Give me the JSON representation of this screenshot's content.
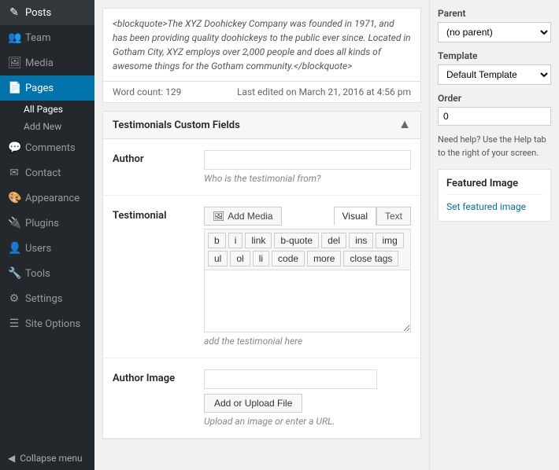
{
  "sidebar": {
    "items": [
      {
        "id": "posts",
        "label": "Posts",
        "icon": "✎"
      },
      {
        "id": "team",
        "label": "Team",
        "icon": "👥"
      },
      {
        "id": "media",
        "label": "Media",
        "icon": "🖼"
      },
      {
        "id": "pages",
        "label": "Pages",
        "icon": "📄",
        "active": true
      },
      {
        "id": "comments",
        "label": "Comments",
        "icon": "💬"
      },
      {
        "id": "contact",
        "label": "Contact",
        "icon": "✉"
      },
      {
        "id": "appearance",
        "label": "Appearance",
        "icon": "🎨"
      },
      {
        "id": "plugins",
        "label": "Plugins",
        "icon": "🔌"
      },
      {
        "id": "users",
        "label": "Users",
        "icon": "👤"
      },
      {
        "id": "tools",
        "label": "Tools",
        "icon": "🔧"
      },
      {
        "id": "settings",
        "label": "Settings",
        "icon": "⚙"
      },
      {
        "id": "site-options",
        "label": "Site Options",
        "icon": "☰"
      }
    ],
    "sub_items": [
      {
        "label": "All Pages",
        "active": true
      },
      {
        "label": "Add New"
      }
    ],
    "collapse_label": "Collapse menu"
  },
  "content": {
    "blockquote_text": "<blockquote>The XYZ Doohickey Company was founded in 1971, and has been providing quality doohickeys to the public ever since. Located in Gotham City, XYZ employs over 2,000 people and does all kinds of awesome things for the Gotham community.</blockquote>",
    "word_count_label": "Word count: 129",
    "last_edited_label": "Last edited on March 21, 2016 at 4:56 pm",
    "custom_fields_title": "Testimonials Custom Fields",
    "author_label": "Author",
    "author_placeholder": "",
    "author_hint": "Who is the testimonial from?",
    "testimonial_label": "Testimonial",
    "add_media_label": "Add Media",
    "visual_tab": "Visual",
    "text_tab": "Text",
    "editor_buttons": [
      "b",
      "i",
      "link",
      "b-quote",
      "del",
      "ins",
      "img",
      "ul",
      "ol",
      "li",
      "code",
      "more",
      "close tags"
    ],
    "editor_placeholder": "add the testimonial here",
    "author_image_label": "Author Image",
    "upload_btn_label": "Add or Upload File",
    "upload_hint": "Upload an image or enter a URL."
  },
  "right_sidebar": {
    "parent_label": "Parent",
    "parent_value": "(no parent)",
    "template_label": "Template",
    "template_value": "Default Template",
    "order_label": "Order",
    "order_value": "0",
    "help_text": "Need help? Use the Help tab to the right of your screen.",
    "featured_image_title": "Featured Image",
    "set_featured_image_label": "Set featured image"
  }
}
